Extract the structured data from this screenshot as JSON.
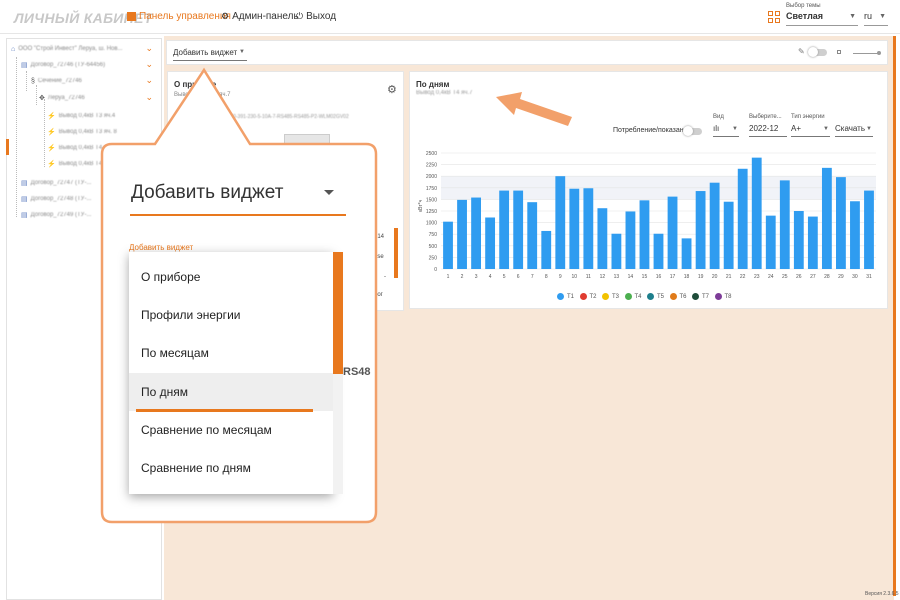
{
  "header": {
    "logo": "ЛИЧНЫЙ КАБИНЕТ",
    "nav": [
      {
        "label": "Панель управления",
        "active": true
      },
      {
        "label": "Админ-панель",
        "active": false
      },
      {
        "label": "Выход",
        "active": false
      }
    ],
    "theme_label": "Выбор темы",
    "theme_value": "Светлая",
    "lang_value": "ru"
  },
  "tree": {
    "items": [
      {
        "label": "ООО \"Строй Инвест\" Леруа, ш. Нов..."
      },
      {
        "label": "Договор_72746 (ТУ-64456)"
      },
      {
        "label": "Сечение_72746"
      },
      {
        "label": "Леруа_72746"
      },
      {
        "label": "Вывод 0,4кВ Т3 яч.4"
      },
      {
        "label": "Вывод 0,4кВ Т3 яч. 8"
      },
      {
        "label": "Вывод 0,4кВ Т4 яч.7"
      },
      {
        "label": "Вывод 0,4кВ Т4 яч.8"
      },
      {
        "label": "Договор_72747 (ТУ-..."
      },
      {
        "label": "Договор_72748 (ТУ-..."
      },
      {
        "label": "Договор_72749 (ТУ-..."
      }
    ]
  },
  "toolbar": {
    "add_widget": "Добавить виджет"
  },
  "widget_device": {
    "title": "О приборе",
    "subtitle": "Вывод 0,4кВ Т4 яч.7",
    "serial_line": "SN 40-391-230-5-10A-7-RS485-RS485-P2-WLM02GV02",
    "side_values": [
      "314",
      "ose",
      "-",
      "рог"
    ]
  },
  "widget_days": {
    "title": "По дням",
    "subtitle": "Вывод 0,4кВ Т4 яч.7",
    "consumption_label": "Потребление/показания",
    "view_label": "Вид",
    "period_label": "Выберите...",
    "period_value": "2022-12",
    "energy_label": "Тип энергии",
    "energy_value": "A+",
    "download_label": "Скачать",
    "legend": [
      {
        "name": "T1",
        "color": "#2f9cf0"
      },
      {
        "name": "T2",
        "color": "#e03c31"
      },
      {
        "name": "T3",
        "color": "#f2c200"
      },
      {
        "name": "T4",
        "color": "#4caf50"
      },
      {
        "name": "T5",
        "color": "#1e7f8c"
      },
      {
        "name": "T6",
        "color": "#e07b1a"
      },
      {
        "name": "T7",
        "color": "#1f4d3a"
      },
      {
        "name": "T8",
        "color": "#7d3c98"
      }
    ]
  },
  "chart_data": {
    "type": "bar",
    "ylabel": "кВт*ч",
    "ylim": [
      0,
      2500
    ],
    "yticks": [
      0,
      250,
      500,
      750,
      1000,
      1250,
      1500,
      1750,
      2000,
      2250,
      2500
    ],
    "categories": [
      "1",
      "2",
      "3",
      "4",
      "5",
      "6",
      "7",
      "8",
      "9",
      "10",
      "11",
      "12",
      "13",
      "14",
      "15",
      "16",
      "17",
      "18",
      "19",
      "20",
      "21",
      "22",
      "23",
      "24",
      "25",
      "26",
      "27",
      "28",
      "29",
      "30",
      "31"
    ],
    "series": [
      {
        "name": "T1",
        "values": [
          1020,
          1490,
          1540,
          1110,
          1690,
          1690,
          1440,
          820,
          2000,
          1730,
          1740,
          1310,
          760,
          1240,
          1480,
          760,
          1560,
          660,
          1680,
          1860,
          1450,
          2160,
          2400,
          1150,
          1910,
          1250,
          1130,
          2180,
          1980,
          1460,
          1690
        ]
      }
    ],
    "grid": true
  },
  "zoom": {
    "title": "Добавить виджет",
    "small_label": "Добавить виджет",
    "options": [
      "О приборе",
      "Профили энергии",
      "По месяцам",
      "По дням",
      "Сравнение по месяцам",
      "Сравнение по дням"
    ],
    "highlighted": "По дням",
    "background_text": "RS48"
  },
  "footer": {
    "version": "Версия 2.3.6.5"
  }
}
